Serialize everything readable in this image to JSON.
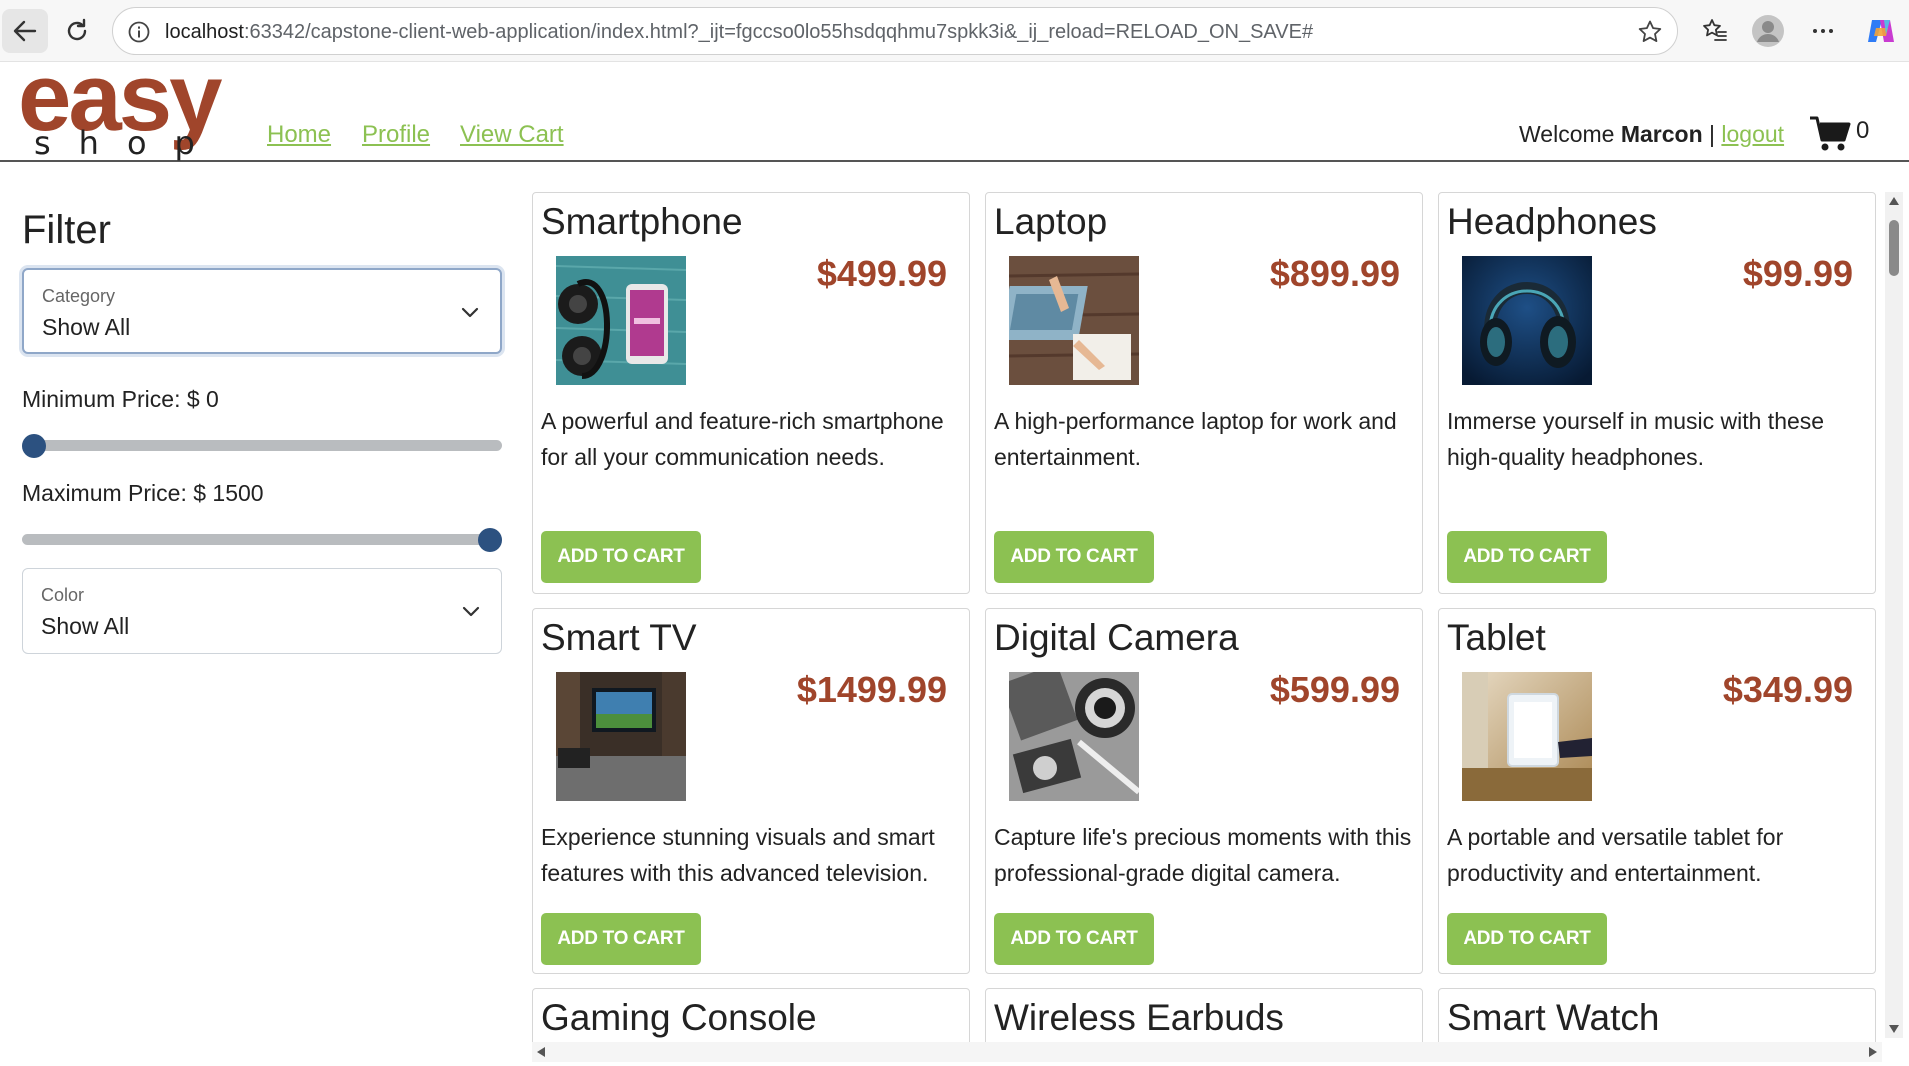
{
  "browser": {
    "url_host": "localhost",
    "url_rest": ":63342/capstone-client-web-application/index.html?_ijt=fgccso0lo55hsdqqhmu7spkk3i&_ij_reload=RELOAD_ON_SAVE#"
  },
  "header": {
    "logo_top": "easy",
    "logo_bottom": "shop",
    "nav": {
      "home": "Home",
      "profile": "Profile",
      "cart": "View Cart"
    },
    "welcome_prefix": "Welcome",
    "user_name": "Marcon",
    "separator": "|",
    "logout": "logout",
    "cart_count": "0"
  },
  "filter": {
    "title": "Filter",
    "category": {
      "label": "Category",
      "value": "Show All"
    },
    "min_price": {
      "label": "Minimum Price: $ 0",
      "value": 0,
      "min": 0,
      "max": 1500
    },
    "max_price": {
      "label": "Maximum Price: $ 1500",
      "value": 1500,
      "min": 0,
      "max": 1500
    },
    "color": {
      "label": "Color",
      "value": "Show All"
    }
  },
  "colors": {
    "brand": "#a0452b",
    "accent_green": "#8cc152",
    "slider_thumb": "#2c5180"
  },
  "products": [
    {
      "name": "Smartphone",
      "price": "$499.99",
      "description": "A powerful and feature-rich smartphone for all your communication needs.",
      "button": "ADD TO CART",
      "image": "smartphone-headphones-photo"
    },
    {
      "name": "Laptop",
      "price": "$899.99",
      "description": "A high-performance laptop for work and entertainment.",
      "button": "ADD TO CART",
      "image": "laptop-desk-photo"
    },
    {
      "name": "Headphones",
      "price": "$99.99",
      "description": "Immerse yourself in music with these high-quality headphones.",
      "button": "ADD TO CART",
      "image": "headphones-photo"
    },
    {
      "name": "Smart TV",
      "price": "$1499.99",
      "description": "Experience stunning visuals and smart features with this advanced television.",
      "button": "ADD TO CART",
      "image": "living-room-tv-photo"
    },
    {
      "name": "Digital Camera",
      "price": "$599.99",
      "description": "Capture life's precious moments with this professional-grade digital camera.",
      "button": "ADD TO CART",
      "image": "camera-photo"
    },
    {
      "name": "Tablet",
      "price": "$349.99",
      "description": "A portable and versatile tablet for productivity and entertainment.",
      "button": "ADD TO CART",
      "image": "tablet-photo"
    },
    {
      "name": "Gaming Console"
    },
    {
      "name": "Wireless Earbuds"
    },
    {
      "name": "Smart Watch"
    }
  ]
}
